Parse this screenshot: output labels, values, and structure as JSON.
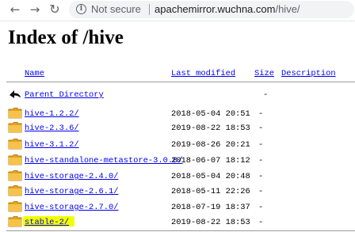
{
  "browser": {
    "security_label": "Not secure",
    "url_host": "apachemirror.wuchna.com",
    "url_path": "/hive/",
    "back_glyph": "←",
    "forward_glyph": "→",
    "reload_glyph": "↻"
  },
  "page": {
    "title": "Index of /hive"
  },
  "table": {
    "headers": {
      "name": "Name",
      "last_modified": "Last modified",
      "size": "Size",
      "description": "Description"
    },
    "parent": {
      "label": "Parent Directory",
      "size": "-",
      "icon": "back-arrow-icon"
    },
    "rows": [
      {
        "name": "hive-1.2.2/",
        "date": "2018-05-04 20:51",
        "size": "-",
        "icon": "folder-icon"
      },
      {
        "name": "hive-2.3.6/",
        "date": "2019-08-22 18:53",
        "size": "-",
        "icon": "folder-icon"
      },
      {
        "name": "hive-3.1.2/",
        "date": "2019-08-26 20:21",
        "size": "-",
        "icon": "folder-icon"
      },
      {
        "name": "hive-standalone-metastore-3.0.0/",
        "date": "2018-06-07 18:12",
        "size": "-",
        "icon": "folder-icon"
      },
      {
        "name": "hive-storage-2.4.0/",
        "date": "2018-05-04 20:48",
        "size": "-",
        "icon": "folder-icon"
      },
      {
        "name": "hive-storage-2.6.1/",
        "date": "2018-05-11 22:26",
        "size": "-",
        "icon": "folder-icon"
      },
      {
        "name": "hive-storage-2.7.0/",
        "date": "2018-07-19 18:37",
        "size": "-",
        "icon": "folder-icon"
      },
      {
        "name": "stable-2/",
        "date": "2019-08-22 18:53",
        "size": "-",
        "icon": "folder-icon"
      }
    ]
  },
  "colors": {
    "link": "#0000ee",
    "highlight": "#f2ff00",
    "folder": "#e8a317"
  }
}
